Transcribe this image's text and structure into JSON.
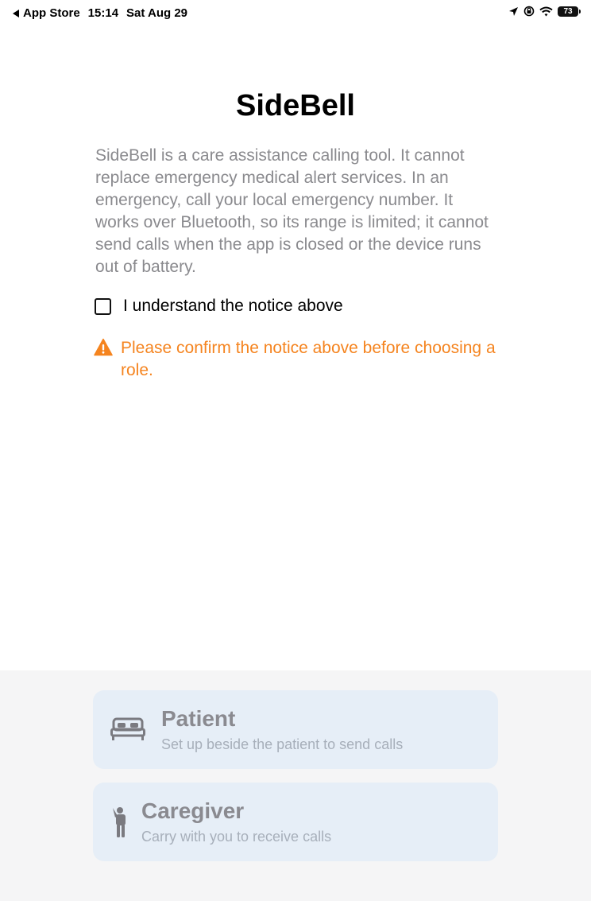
{
  "status_bar": {
    "back_label": "App Store",
    "time": "15:14",
    "date": "Sat Aug 29",
    "battery": "73",
    "icons": [
      "location-arrow-icon",
      "orientation-lock-icon",
      "wifi-icon",
      "battery-icon"
    ]
  },
  "app": {
    "title": "SideBell",
    "notice": "SideBell is a care assistance calling tool. It cannot replace emergency medical alert services. In an emergency, call your local emergency number. It works over Bluetooth, so its range is limited; it cannot send calls when the app is closed or the device runs out of battery.",
    "checkbox_label": "I understand the notice above",
    "checkbox_checked": false,
    "warning": "Please confirm the notice above before choosing a role."
  },
  "roles": {
    "patient": {
      "title": "Patient",
      "subtitle": "Set up beside the patient to send calls",
      "icon": "bed-icon"
    },
    "caregiver": {
      "title": "Caregiver",
      "subtitle": "Carry with you to receive calls",
      "icon": "person-waving-icon"
    }
  },
  "colors": {
    "warning": "#f5841f",
    "card_background": "#e6eef7",
    "notice_text": "#8a8a8e"
  }
}
